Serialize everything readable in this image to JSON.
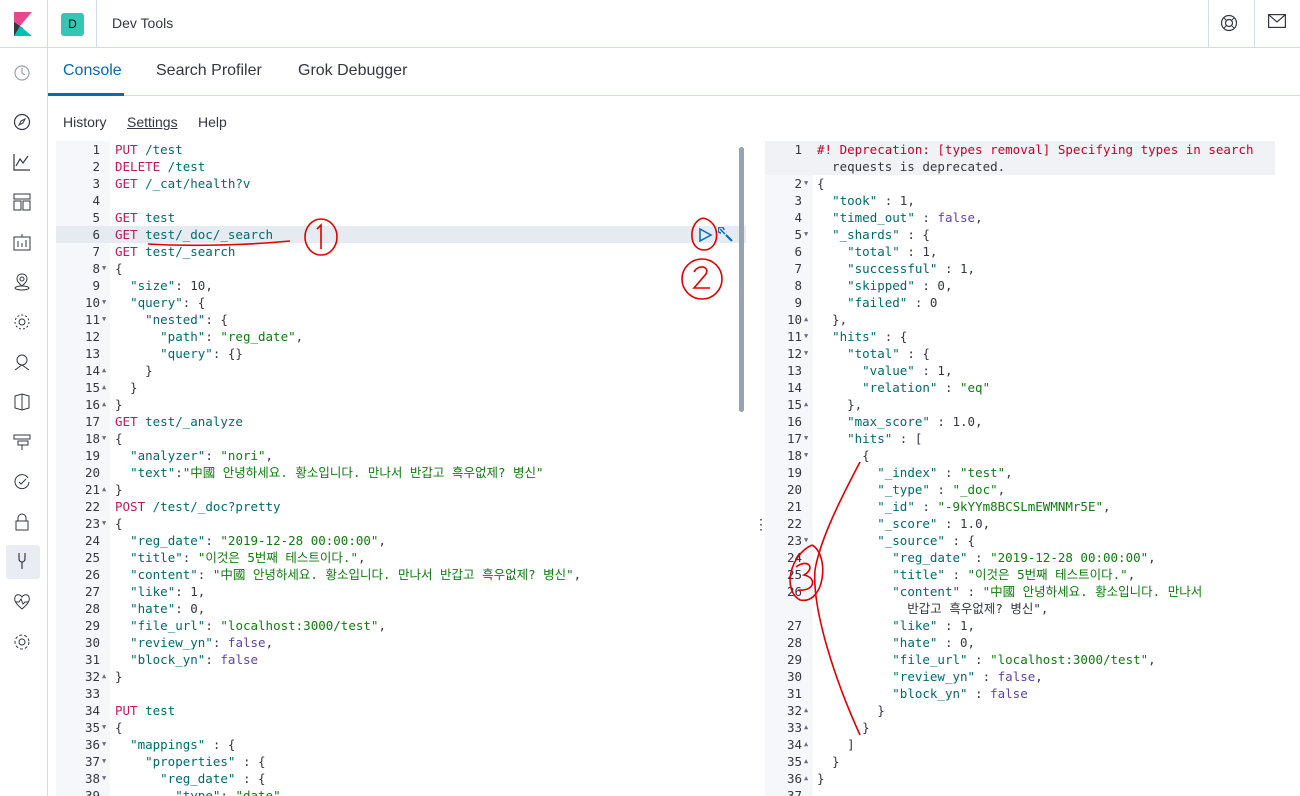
{
  "header": {
    "app_title": "Dev Tools",
    "space_initial": "D"
  },
  "tabs": [
    {
      "label": "Console"
    },
    {
      "label": "Search Profiler"
    },
    {
      "label": "Grok Debugger"
    }
  ],
  "subnav": {
    "history": "History",
    "settings": "Settings",
    "help": "Help"
  },
  "nav_icons": [
    "clock-icon",
    "compass-icon",
    "visualize-icon",
    "dashboard-icon",
    "canvas-icon",
    "maps-icon",
    "ml-icon",
    "metrics-icon",
    "logs-icon",
    "apm-icon",
    "uptime-icon",
    "security-icon",
    "devtools-icon",
    "monitoring-icon",
    "management-icon"
  ],
  "annotations": [
    "1",
    "2",
    "3"
  ],
  "request_editor": {
    "lines": [
      {
        "n": "1",
        "t": "PUT /test"
      },
      {
        "n": "2",
        "t": "DELETE /test"
      },
      {
        "n": "3",
        "t": "GET /_cat/health?v"
      },
      {
        "n": "4",
        "t": ""
      },
      {
        "n": "5",
        "t": "GET test"
      },
      {
        "n": "6",
        "t": "GET test/_doc/_search"
      },
      {
        "n": "7",
        "t": "GET test/_search"
      },
      {
        "n": "8",
        "t": "{"
      },
      {
        "n": "9",
        "t": "  \"size\": 10,"
      },
      {
        "n": "10",
        "t": "  \"query\": {"
      },
      {
        "n": "11",
        "t": "    \"nested\": {"
      },
      {
        "n": "12",
        "t": "      \"path\": \"reg_date\","
      },
      {
        "n": "13",
        "t": "      \"query\": {}"
      },
      {
        "n": "14",
        "t": "    }"
      },
      {
        "n": "15",
        "t": "  }"
      },
      {
        "n": "16",
        "t": "}"
      },
      {
        "n": "17",
        "t": "GET test/_analyze"
      },
      {
        "n": "18",
        "t": "{"
      },
      {
        "n": "19",
        "t": "  \"analyzer\": \"nori\","
      },
      {
        "n": "20",
        "t": "  \"text\":\"中國 안녕하세요. 황소입니다. 만나서 반갑고 흑우없제? 병신\""
      },
      {
        "n": "21",
        "t": "}"
      },
      {
        "n": "22",
        "t": "POST /test/_doc?pretty"
      },
      {
        "n": "23",
        "t": "{"
      },
      {
        "n": "24",
        "t": "  \"reg_date\": \"2019-12-28 00:00:00\","
      },
      {
        "n": "25",
        "t": "  \"title\": \"이것은 5번째 테스트이다.\","
      },
      {
        "n": "26",
        "t": "  \"content\": \"中國 안녕하세요. 황소입니다. 만나서 반갑고 흑우없제? 병신\","
      },
      {
        "n": "27",
        "t": "  \"like\": 1,"
      },
      {
        "n": "28",
        "t": "  \"hate\": 0,"
      },
      {
        "n": "29",
        "t": "  \"file_url\": \"localhost:3000/test\","
      },
      {
        "n": "30",
        "t": "  \"review_yn\": false,"
      },
      {
        "n": "31",
        "t": "  \"block_yn\": false"
      },
      {
        "n": "32",
        "t": "}"
      },
      {
        "n": "33",
        "t": ""
      },
      {
        "n": "34",
        "t": "PUT test"
      },
      {
        "n": "35",
        "t": "{"
      },
      {
        "n": "36",
        "t": "  \"mappings\" : {"
      },
      {
        "n": "37",
        "t": "    \"properties\" : {"
      },
      {
        "n": "38",
        "t": "      \"reg_date\" : {"
      },
      {
        "n": "39",
        "t": "        \"type\": \"date\""
      }
    ]
  },
  "response_editor": {
    "lines": [
      {
        "n": "1",
        "t": "#! Deprecation: [types removal] Specifying types in search"
      },
      {
        "n": "",
        "t": "  requests is deprecated."
      },
      {
        "n": "2",
        "t": "{"
      },
      {
        "n": "3",
        "t": "  \"took\" : 1,"
      },
      {
        "n": "4",
        "t": "  \"timed_out\" : false,"
      },
      {
        "n": "5",
        "t": "  \"_shards\" : {"
      },
      {
        "n": "6",
        "t": "    \"total\" : 1,"
      },
      {
        "n": "7",
        "t": "    \"successful\" : 1,"
      },
      {
        "n": "8",
        "t": "    \"skipped\" : 0,"
      },
      {
        "n": "9",
        "t": "    \"failed\" : 0"
      },
      {
        "n": "10",
        "t": "  },"
      },
      {
        "n": "11",
        "t": "  \"hits\" : {"
      },
      {
        "n": "12",
        "t": "    \"total\" : {"
      },
      {
        "n": "13",
        "t": "      \"value\" : 1,"
      },
      {
        "n": "14",
        "t": "      \"relation\" : \"eq\""
      },
      {
        "n": "15",
        "t": "    },"
      },
      {
        "n": "16",
        "t": "    \"max_score\" : 1.0,"
      },
      {
        "n": "17",
        "t": "    \"hits\" : ["
      },
      {
        "n": "18",
        "t": "      {"
      },
      {
        "n": "19",
        "t": "        \"_index\" : \"test\","
      },
      {
        "n": "20",
        "t": "        \"_type\" : \"_doc\","
      },
      {
        "n": "21",
        "t": "        \"_id\" : \"-9kYYm8BCSLmEWMNMr5E\","
      },
      {
        "n": "22",
        "t": "        \"_score\" : 1.0,"
      },
      {
        "n": "23",
        "t": "        \"_source\" : {"
      },
      {
        "n": "24",
        "t": "          \"reg_date\" : \"2019-12-28 00:00:00\","
      },
      {
        "n": "25",
        "t": "          \"title\" : \"이것은 5번째 테스트이다.\","
      },
      {
        "n": "26",
        "t": "          \"content\" : \"中國 안녕하세요. 황소입니다. 만나서"
      },
      {
        "n": "",
        "t": "            반갑고 흑우없제? 병신\","
      },
      {
        "n": "27",
        "t": "          \"like\" : 1,"
      },
      {
        "n": "28",
        "t": "          \"hate\" : 0,"
      },
      {
        "n": "29",
        "t": "          \"file_url\" : \"localhost:3000/test\","
      },
      {
        "n": "30",
        "t": "          \"review_yn\" : false,"
      },
      {
        "n": "31",
        "t": "          \"block_yn\" : false"
      },
      {
        "n": "32",
        "t": "        }"
      },
      {
        "n": "33",
        "t": "      }"
      },
      {
        "n": "34",
        "t": "    ]"
      },
      {
        "n": "35",
        "t": "  }"
      },
      {
        "n": "36",
        "t": "}"
      },
      {
        "n": "37",
        "t": ""
      }
    ]
  }
}
